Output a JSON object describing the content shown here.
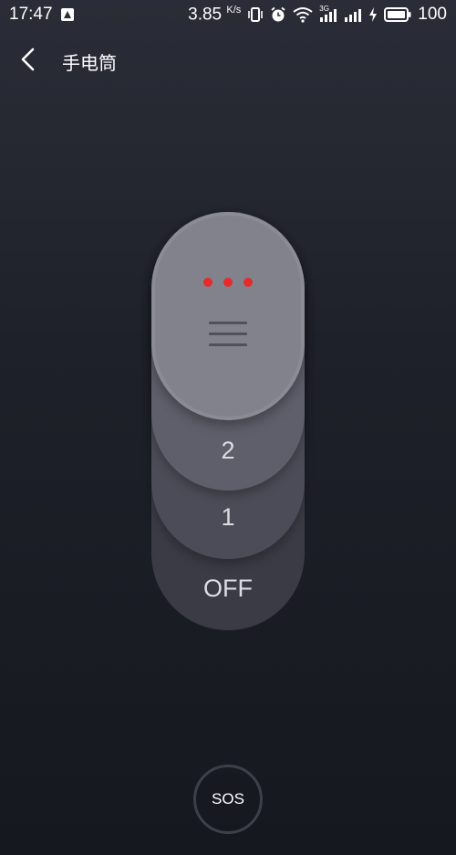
{
  "status_bar": {
    "time": "17:47",
    "net_speed_value": "3.85",
    "net_speed_unit": "K/s",
    "signal_label": "3G",
    "battery": "100"
  },
  "header": {
    "title": "手电筒"
  },
  "switch": {
    "levels": [
      "2",
      "1",
      "OFF"
    ],
    "current_level": "3",
    "indicator_color": "#e52b2b"
  },
  "sos": {
    "label": "SOS"
  },
  "colors": {
    "background_top": "#2a2c37",
    "background_bottom": "#16181f",
    "knob": "#8a8b95"
  }
}
